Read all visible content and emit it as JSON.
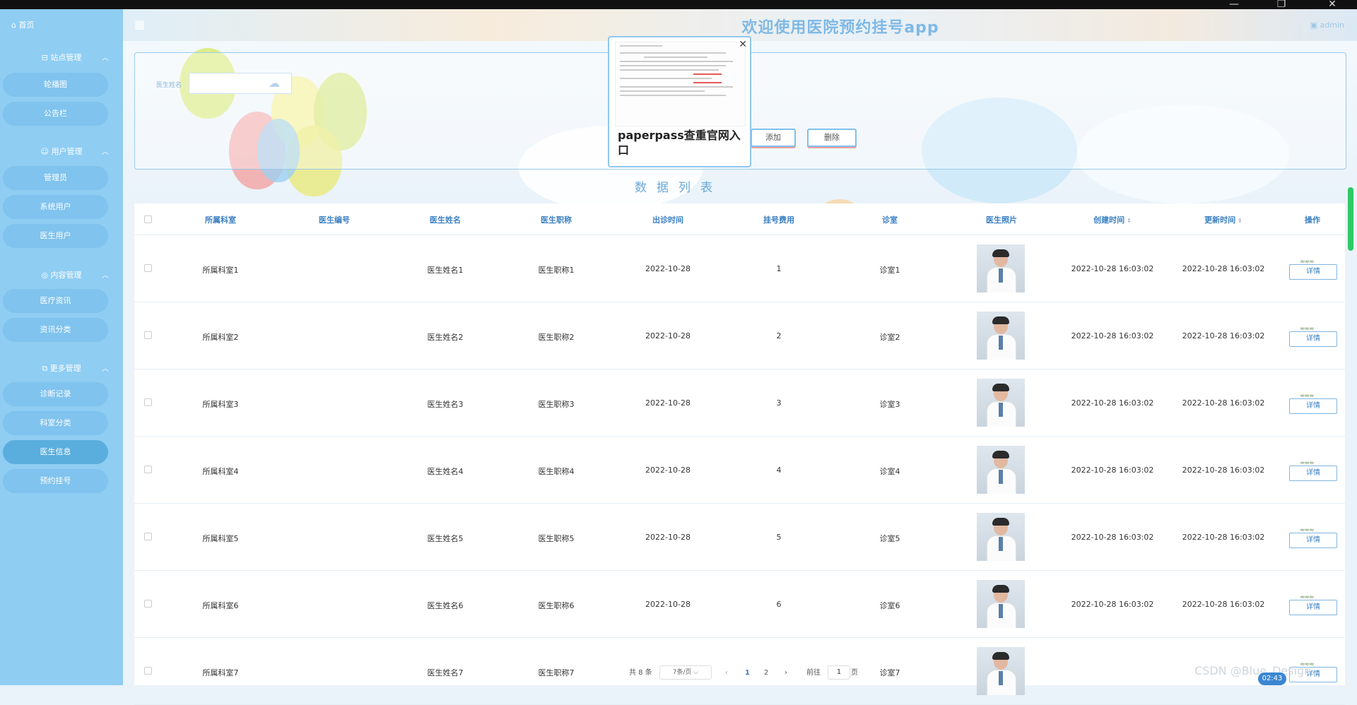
{
  "window": {
    "minimize": "—",
    "maximize": "❐",
    "close": "✕"
  },
  "sidebar": {
    "home": "首页",
    "groups": [
      {
        "label": "站点管理",
        "items": [
          "轮播图",
          "公告栏"
        ]
      },
      {
        "label": "用户管理",
        "items": [
          "管理员",
          "系统用户",
          "医生用户"
        ]
      },
      {
        "label": "内容管理",
        "items": [
          "医疗资讯",
          "资讯分类"
        ]
      },
      {
        "label": "更多管理",
        "items": [
          "诊断记录",
          "科室分类",
          "医生信息",
          "预约挂号"
        ]
      }
    ],
    "active_item": "医生信息"
  },
  "header": {
    "title": "欢迎使用医院预约挂号app",
    "user": "admin"
  },
  "search": {
    "label": "医生姓名",
    "placeholder": "",
    "add_button": "添加",
    "delete_button": "删除"
  },
  "popup": {
    "text": "paperpass查重官网入口"
  },
  "list_title": "数据列表",
  "table": {
    "columns": [
      "所属科室",
      "医生编号",
      "医生姓名",
      "医生职称",
      "出诊时间",
      "挂号费用",
      "诊室",
      "医生照片",
      "创建时间",
      "更新时间",
      "操作"
    ],
    "rows": [
      {
        "dept": "所属科室1",
        "id": "",
        "name": "医生姓名1",
        "title": "医生职称1",
        "date": "2022-10-28",
        "fee": "1",
        "room": "诊室1",
        "created": "2022-10-28 16:03:02",
        "updated": "2022-10-28 16:03:02",
        "action": "详情"
      },
      {
        "dept": "所属科室2",
        "id": "",
        "name": "医生姓名2",
        "title": "医生职称2",
        "date": "2022-10-28",
        "fee": "2",
        "room": "诊室2",
        "created": "2022-10-28 16:03:02",
        "updated": "2022-10-28 16:03:02",
        "action": "详情"
      },
      {
        "dept": "所属科室3",
        "id": "",
        "name": "医生姓名3",
        "title": "医生职称3",
        "date": "2022-10-28",
        "fee": "3",
        "room": "诊室3",
        "created": "2022-10-28 16:03:02",
        "updated": "2022-10-28 16:03:02",
        "action": "详情"
      },
      {
        "dept": "所属科室4",
        "id": "",
        "name": "医生姓名4",
        "title": "医生职称4",
        "date": "2022-10-28",
        "fee": "4",
        "room": "诊室4",
        "created": "2022-10-28 16:03:02",
        "updated": "2022-10-28 16:03:02",
        "action": "详情"
      },
      {
        "dept": "所属科室5",
        "id": "",
        "name": "医生姓名5",
        "title": "医生职称5",
        "date": "2022-10-28",
        "fee": "5",
        "room": "诊室5",
        "created": "2022-10-28 16:03:02",
        "updated": "2022-10-28 16:03:02",
        "action": "详情"
      },
      {
        "dept": "所属科室6",
        "id": "",
        "name": "医生姓名6",
        "title": "医生职称6",
        "date": "2022-10-28",
        "fee": "6",
        "room": "诊室6",
        "created": "2022-10-28 16:03:02",
        "updated": "2022-10-28 16:03:02",
        "action": "详情"
      },
      {
        "dept": "所属科室7",
        "id": "",
        "name": "医生姓名7",
        "title": "医生职称7",
        "date": "",
        "fee": "",
        "room": "诊室7",
        "created": "",
        "updated": "",
        "action": "详情"
      }
    ]
  },
  "pagination": {
    "total": "共 8 条",
    "page_size": "7条/页",
    "pages": [
      "1",
      "2"
    ],
    "current": "1",
    "goto_prefix": "前往",
    "goto_value": "1",
    "goto_suffix": "页"
  },
  "overlay": {
    "watermark": "CSDN @Blue_Design",
    "clock": "02:43"
  },
  "colors": {
    "sidebar_bg": "#8fcdf2",
    "accent": "#3a7fc1",
    "header_title": "#7fb9e6"
  }
}
